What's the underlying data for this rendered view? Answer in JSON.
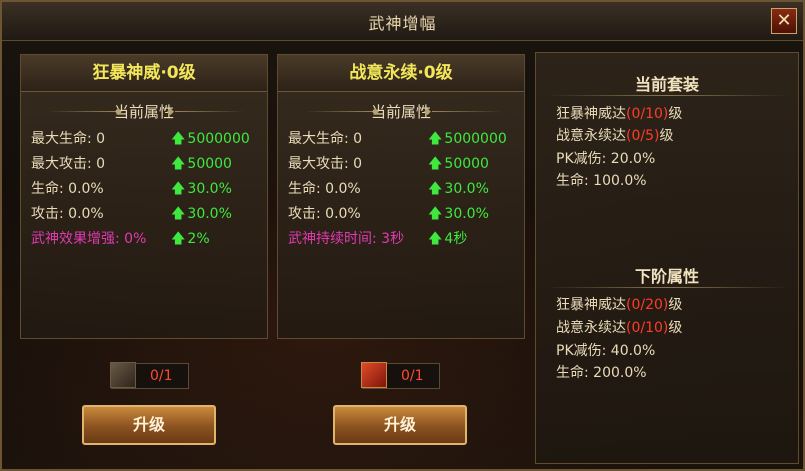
{
  "window": {
    "title": "武神增幅"
  },
  "panels": [
    {
      "title": "狂暴神威·0级",
      "attr_header": "当前属性",
      "rows": [
        {
          "key": "最大生命: 0",
          "value": "5000000"
        },
        {
          "key": "最大攻击: 0",
          "value": "50000"
        },
        {
          "key": "生命: 0.0%",
          "value": "30.0%"
        },
        {
          "key": "攻击: 0.0%",
          "value": "30.0%"
        },
        {
          "key": "武神效果增强: 0%",
          "value": "2%"
        }
      ],
      "item_count": "0/1",
      "button": "升级"
    },
    {
      "title": "战意永续·0级",
      "attr_header": "当前属性",
      "rows": [
        {
          "key": "最大生命: 0",
          "value": "5000000"
        },
        {
          "key": "最大攻击: 0",
          "value": "50000"
        },
        {
          "key": "生命: 0.0%",
          "value": "30.0%"
        },
        {
          "key": "攻击: 0.0%",
          "value": "30.0%"
        },
        {
          "key": "武神持续时间: 3秒",
          "value": "4秒"
        }
      ],
      "item_count": "0/1",
      "button": "升级"
    }
  ],
  "side": {
    "current": {
      "title": "当前套装",
      "req1": {
        "pre": "狂暴神威达",
        "count": "(0/10)",
        "post": "级"
      },
      "req2": {
        "pre": "战意永续达",
        "count": "(0/5)",
        "post": "级"
      },
      "stat1": "PK减伤: 20.0%",
      "stat2": "生命: 100.0%"
    },
    "next": {
      "title": "下阶属性",
      "req1": {
        "pre": "狂暴神威达",
        "count": "(0/20)",
        "post": "级"
      },
      "req2": {
        "pre": "战意永续达",
        "count": "(0/10)",
        "post": "级"
      },
      "stat1": "PK减伤: 40.0%",
      "stat2": "生命: 200.0%"
    }
  },
  "icons": {
    "close": "close-icon",
    "up_arrow": "up-arrow-icon",
    "item1": "scroll-icon",
    "item2": "red-book-icon"
  },
  "colors": {
    "title_yellow": "#f2e65a",
    "gain_green": "#3fe83f",
    "special_pink": "#e03ab0",
    "red_count": "#ff3b2b"
  }
}
